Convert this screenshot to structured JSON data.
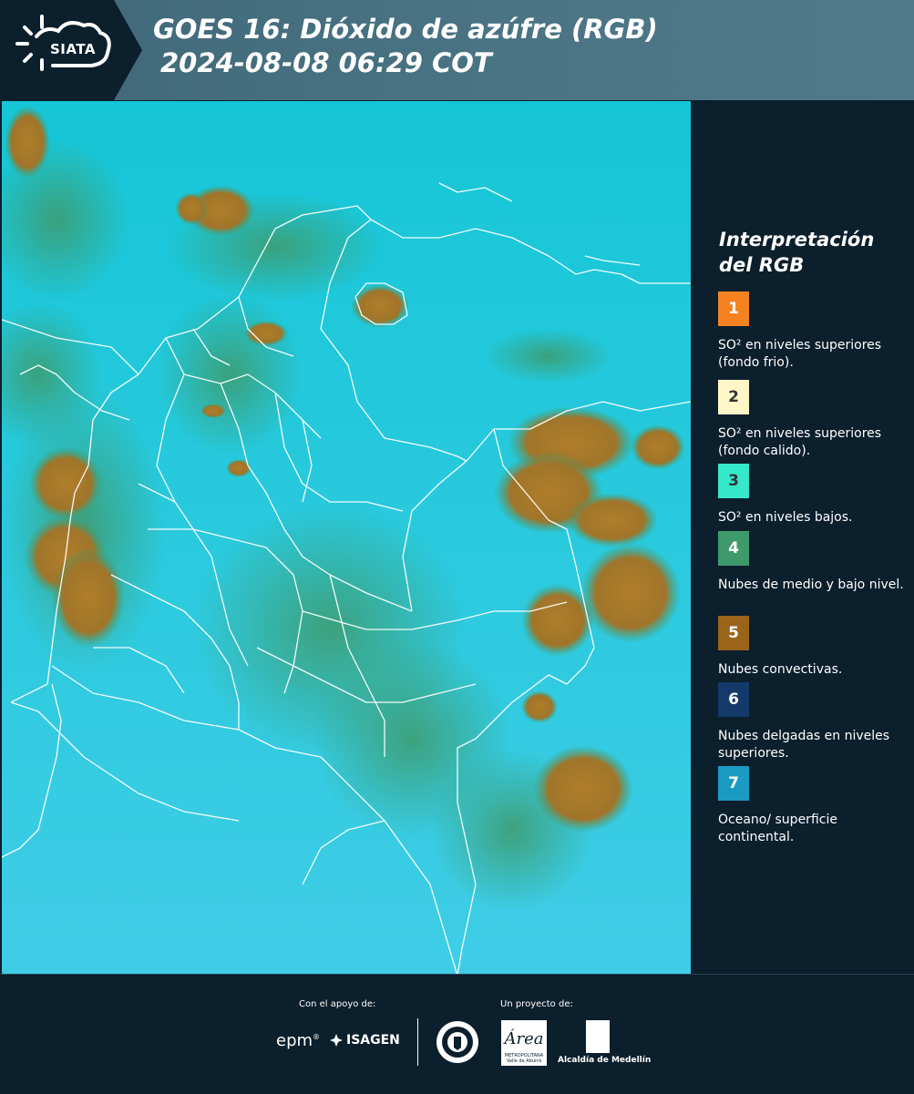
{
  "header": {
    "logo_text": "SIATA",
    "title_line1": "GOES 16: Dióxido de azúfre (RGB)",
    "title_line2": "2024-08-08 06:29 COT"
  },
  "legend": {
    "title": "Interpretación del RGB",
    "items": [
      {
        "number": "1",
        "label": "SO² en niveles superiores (fondo frio).",
        "color": "#f58220",
        "text_color": "#ffffff"
      },
      {
        "number": "2",
        "label": "SO² en niveles superiores (fondo calido).",
        "color": "#fff6c8",
        "text_color": "#333333"
      },
      {
        "number": "3",
        "label": "SO² en niveles bajos.",
        "color": "#34e8c9",
        "text_color": "#333333"
      },
      {
        "number": "4",
        "label": "Nubes de medio y bajo nivel.",
        "color": "#3f9a6b",
        "text_color": "#ffffff"
      },
      {
        "number": "5",
        "label": "Nubes convectivas.",
        "color": "#9a6419",
        "text_color": "#ffffff"
      },
      {
        "number": "6",
        "label": "Nubes delgadas en niveles superiores.",
        "color": "#143a6b",
        "text_color": "#ffffff"
      },
      {
        "number": "7",
        "label": "Oceano/ superficie continental.",
        "color": "#1b9bc4",
        "text_color": "#ffffff"
      }
    ]
  },
  "map_colors": {
    "background": "#1fc9d8",
    "convective": "#a6792a",
    "mid_low": "#3f9a6b",
    "borders": "#ffffff"
  },
  "footer": {
    "support_label": "Con el apoyo de:",
    "project_label": "Un proyecto de:",
    "epm": "epm",
    "isagen": "ISAGEN",
    "area_logo": "Área",
    "area_caption": "METROPOLITANA Valle de Aburrá",
    "alcaldia": "Alcaldía de Medellín"
  }
}
